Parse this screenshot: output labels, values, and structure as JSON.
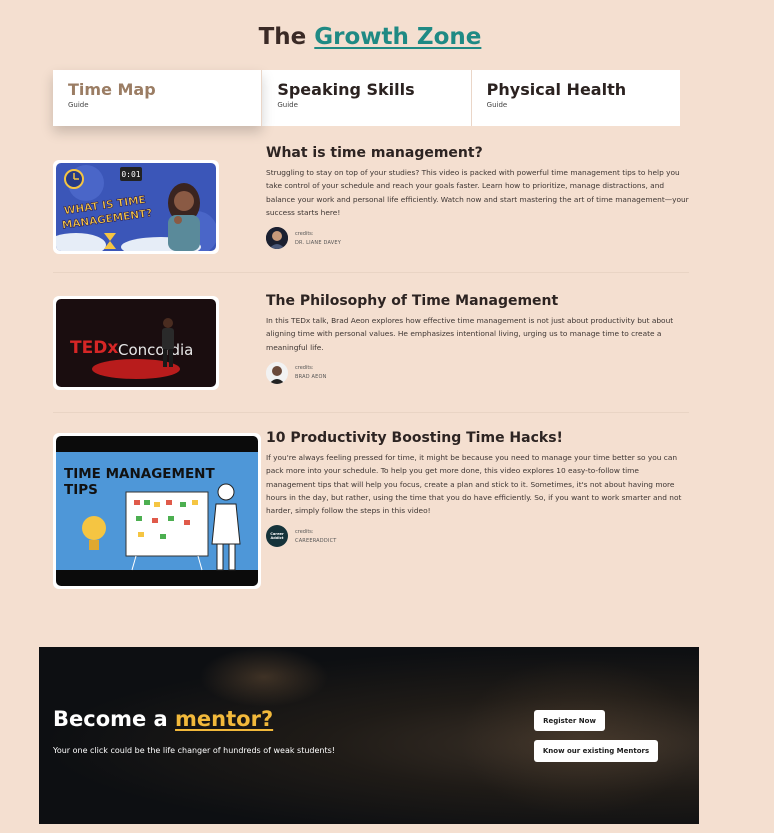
{
  "header": {
    "title_prefix": "The",
    "title_accent": "Growth Zone"
  },
  "tabs": [
    {
      "title": "Time Map",
      "sub": "Guide",
      "active": true
    },
    {
      "title": "Speaking Skills",
      "sub": "Guide"
    },
    {
      "title": "Physical Health",
      "sub": "Guide"
    }
  ],
  "cards": [
    {
      "title": "What is time management?",
      "description": "Struggling to stay on top of your studies? This video is packed with powerful time management tips to help you take control of your schedule and reach your goals faster. Learn how to prioritize, manage distractions, and balance your work and personal life efficiently. Watch now and start mastering the art of time management—your success starts here!",
      "credit_label": "credits:",
      "credit_name": "DR. LIANE DAVEY",
      "thumb_text": "WHAT IS TIME MANAGEMENT?",
      "clock_text": "0:01"
    },
    {
      "title": "The Philosophy of Time Management",
      "description": "In this TEDx talk, Brad Aeon explores how effective time management is not just about productivity but about aligning time with personal values. He emphasizes intentional living, urging us to manage time to create a meaningful life.",
      "credit_label": "credits:",
      "credit_name": "BRAD AEON",
      "thumb_text_a": "TEDx",
      "thumb_text_b": "Concordia"
    },
    {
      "title": "10 Productivity Boosting Time Hacks!",
      "description": "If you're always feeling pressed for time, it might be because you need to manage your time better so you can pack more into your schedule. To help you get more done, this video explores 10 easy-to-follow time management tips that will help you focus, create a plan and stick to it. Sometimes, it's not about having more hours in the day, but rather, using the time that you do have efficiently. So, if you want to work smarter and not harder, simply follow the steps in this video!",
      "credit_label": "credits:",
      "credit_name": "CAREERADDICT",
      "avatar_text": "Career Addict",
      "thumb_text_a": "TIME MANAGEMENT",
      "thumb_text_b": "TIPS"
    }
  ],
  "mentor": {
    "title_prefix": "Become a",
    "title_accent": "mentor?",
    "subtitle": "Your one click could be the life changer of hundreds of weak students!",
    "register_label": "Register Now",
    "mentors_label": "Know our existing Mentors"
  },
  "colors": {
    "background": "#f4dfd0",
    "accent_teal": "#1f8a84",
    "accent_gold": "#f2b93b",
    "active_tab": "#9b7d64"
  }
}
